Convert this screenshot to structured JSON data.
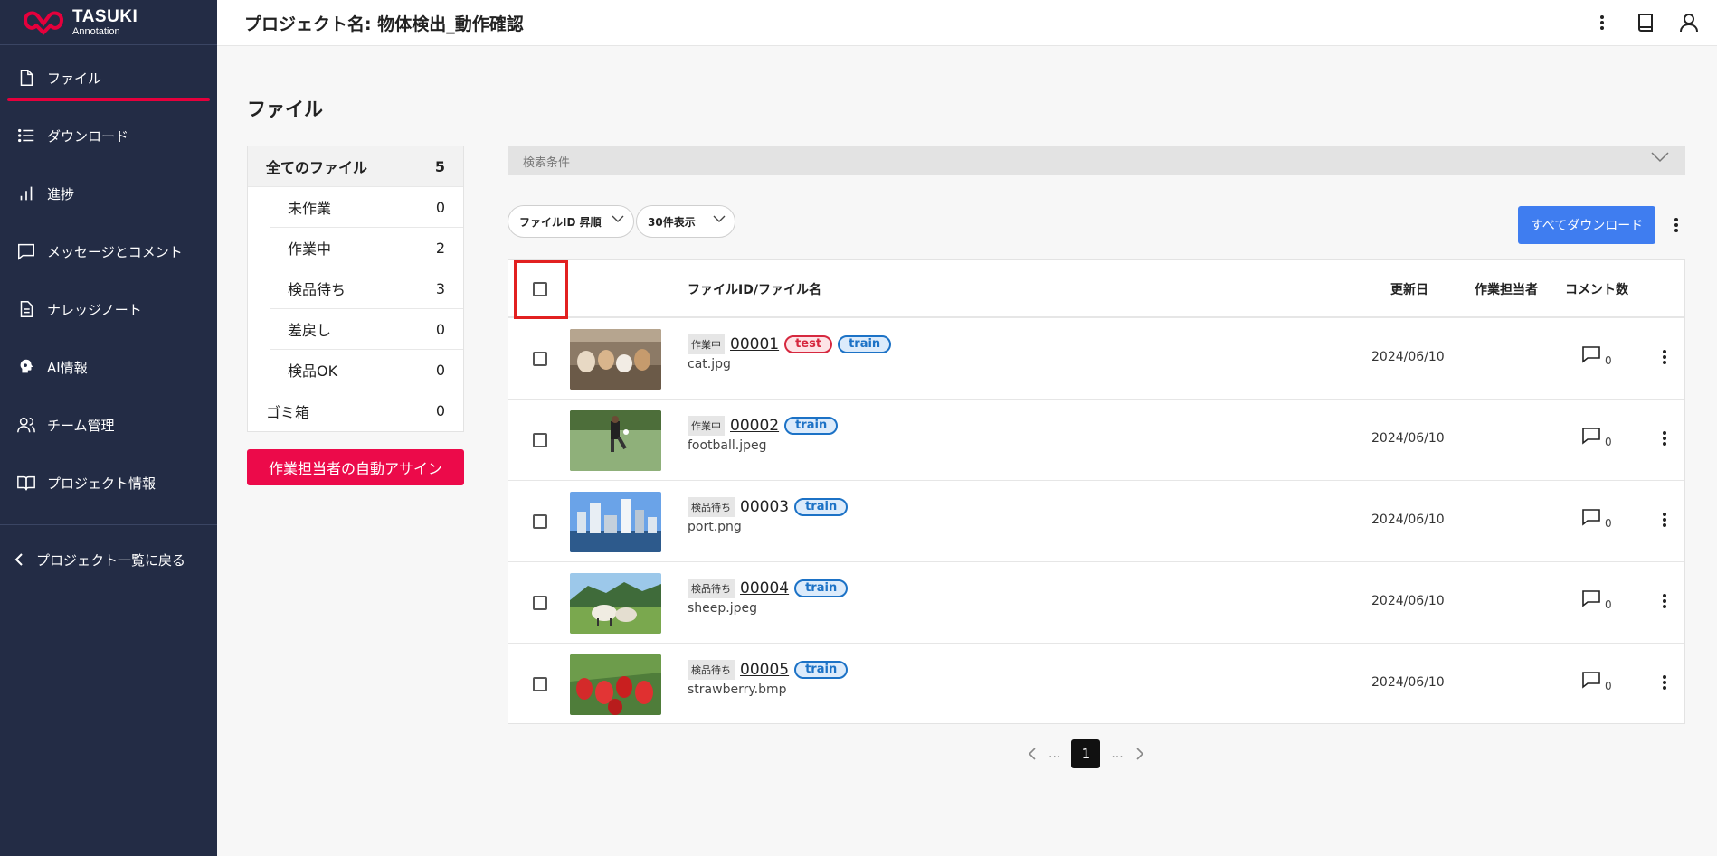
{
  "app": {
    "logo_main": "TASUKI",
    "logo_sub": "Annotation"
  },
  "header": {
    "title": "プロジェクト名: 物体検出_動作確認",
    "icons": [
      "more-vert-icon",
      "book-icon",
      "user-icon"
    ]
  },
  "sidebar": {
    "items": [
      {
        "label": "ファイル",
        "icon": "file-icon",
        "active": true
      },
      {
        "label": "ダウンロード",
        "icon": "list-icon"
      },
      {
        "label": "進捗",
        "icon": "bar-chart-icon"
      },
      {
        "label": "メッセージとコメント",
        "icon": "message-icon"
      },
      {
        "label": "ナレッジノート",
        "icon": "document-icon"
      },
      {
        "label": "AI情報",
        "icon": "ai-head-icon"
      },
      {
        "label": "チーム管理",
        "icon": "team-icon"
      },
      {
        "label": "プロジェクト情報",
        "icon": "open-book-icon"
      }
    ],
    "back_label": "プロジェクト一覧に戻る"
  },
  "main": {
    "page_title": "ファイル",
    "filters": [
      {
        "label": "全てのファイル",
        "count": "5"
      },
      {
        "label": "未作業",
        "count": "0"
      },
      {
        "label": "作業中",
        "count": "2"
      },
      {
        "label": "検品待ち",
        "count": "3"
      },
      {
        "label": "差戻し",
        "count": "0"
      },
      {
        "label": "検品OK",
        "count": "0"
      },
      {
        "label": "ゴミ箱",
        "count": "0"
      }
    ],
    "auto_assign_label": "作業担当者の自動アサイン",
    "search_label": "検索条件",
    "sort_select": "ファイルID 昇順",
    "count_select": "30件表示",
    "download_all_label": "すべてダウンロード",
    "table": {
      "headers": {
        "file": "ファイルID/ファイル名",
        "updated": "更新日",
        "assignee": "作業担当者",
        "comments": "コメント数"
      },
      "rows": [
        {
          "status": "作業中",
          "id": "00001",
          "tags": [
            "test",
            "train"
          ],
          "filename": "cat.jpg",
          "date": "2024/06/10",
          "comments": "0",
          "thumb": "cat"
        },
        {
          "status": "作業中",
          "id": "00002",
          "tags": [
            "train"
          ],
          "filename": "football.jpeg",
          "date": "2024/06/10",
          "comments": "0",
          "thumb": "football"
        },
        {
          "status": "検品待ち",
          "id": "00003",
          "tags": [
            "train"
          ],
          "filename": "port.png",
          "date": "2024/06/10",
          "comments": "0",
          "thumb": "port"
        },
        {
          "status": "検品待ち",
          "id": "00004",
          "tags": [
            "train"
          ],
          "filename": "sheep.jpeg",
          "date": "2024/06/10",
          "comments": "0",
          "thumb": "sheep"
        },
        {
          "status": "検品待ち",
          "id": "00005",
          "tags": [
            "train"
          ],
          "filename": "strawberry.bmp",
          "date": "2024/06/10",
          "comments": "0",
          "thumb": "strawberry"
        }
      ]
    },
    "pagination": {
      "ellipsis": "...",
      "current": "1"
    }
  },
  "colors": {
    "sidebar_bg": "#232c45",
    "accent_red": "#ec0a4a",
    "primary_blue": "#3f7df0",
    "tag_test": "#d6283f",
    "tag_train": "#1c72c6"
  }
}
